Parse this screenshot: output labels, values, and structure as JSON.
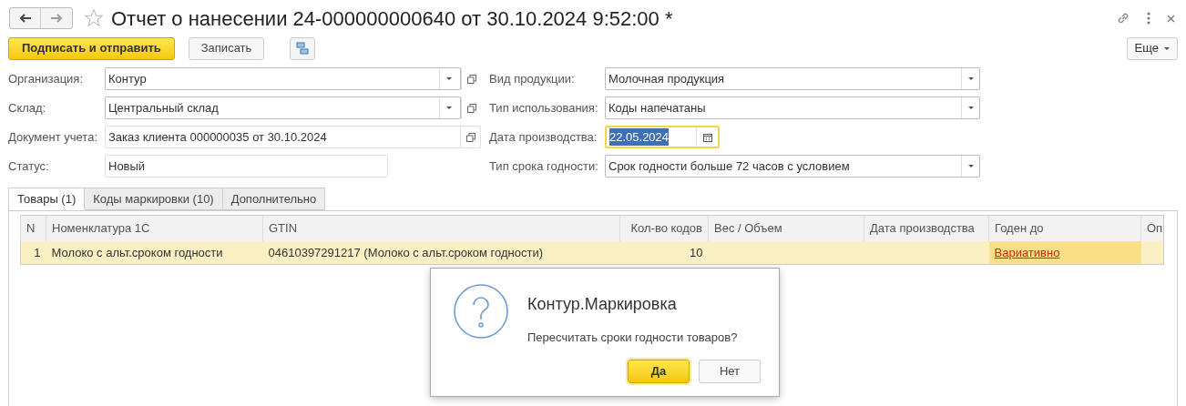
{
  "window": {
    "title": "Отчет о нанесении 24-000000000640 от 30.10.2024 9:52:00 *",
    "favorite": false
  },
  "toolbar": {
    "buttons": [
      {
        "label": "Подписать и отправить",
        "kind": "primary"
      },
      {
        "label": "Записать",
        "kind": "default"
      }
    ],
    "more": "Еще"
  },
  "fields_left": [
    {
      "label": "Организация:",
      "value": "Контур",
      "kind": "combo"
    },
    {
      "label": "Склад:",
      "value": "Центральный склад",
      "kind": "combo"
    },
    {
      "label": "Документ учета:",
      "value": "Заказ клиента 000000035 от 30.10.2024",
      "kind": "link"
    },
    {
      "label": "Статус:",
      "value": "Новый",
      "kind": "text"
    }
  ],
  "fields_right": [
    {
      "label": "Вид продукции:",
      "value": "Молочная продукция",
      "kind": "select"
    },
    {
      "label": "Тип использования:",
      "value": "Коды напечатаны",
      "kind": "select"
    },
    {
      "label": "Дата производства:",
      "value": "22.05.2024",
      "kind": "date",
      "focused": true
    },
    {
      "label": "Тип срока годности:",
      "value": "Срок годности больше 72 часов с условием",
      "kind": "select"
    }
  ],
  "tabs": [
    {
      "label": "Товары (1)",
      "selected": true
    },
    {
      "label": "Коды маркировки (10)",
      "selected": false
    },
    {
      "label": "Дополнительно",
      "selected": false
    }
  ],
  "table": {
    "columns": [
      "N",
      "Номенклатура 1С",
      "GTIN",
      "Кол-во кодов",
      "Вес / Объем",
      "Дата производства",
      "Годен до",
      "Оп"
    ],
    "rows": [
      {
        "selected": true,
        "cells": [
          "1",
          "Молоко с альт.сроком годности",
          "04610397291217 (Молоко с альт.сроком годности)",
          "10",
          "",
          "",
          "Вариативно",
          ""
        ]
      }
    ]
  },
  "dialog": {
    "title": "Контур.Маркировка",
    "message": "Пересчитать сроки годности товаров?",
    "buttons": [
      {
        "label": "Да",
        "default": true
      },
      {
        "label": "Нет",
        "default": false
      }
    ]
  }
}
